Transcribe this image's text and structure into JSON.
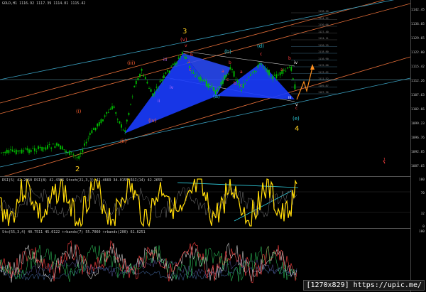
{
  "header": {
    "symbol_info": "GOLD,H1  1116.92 1117.39 1114.81 1115.42",
    "rsi_info": "RSI(5) 42.2050  RSI(8) 42.4385  Stoch(21,3,3) 42.4669 34.0155  RSI(14) 42.2655",
    "sto_info": "Sto(55,3,4) 40.7511 45.0122  +rbands(7) 55.7060  +rbands(200) 61.6251"
  },
  "price_axis": [
    "1142.45",
    "1136.05",
    "1129.65",
    "1122.00",
    "1115.42",
    "1112.26",
    "1107.63",
    "1102.66",
    "1099.23",
    "1096.76",
    "1092.85",
    "1087.65"
  ],
  "rsi_axis": [
    "100",
    "70",
    "32",
    "0"
  ],
  "sto_axis": [
    "100",
    "0"
  ],
  "fib_levels": [
    "1138.40",
    "1134.52",
    "1130.66",
    "1127.40",
    "1124.11",
    "1120.25",
    "1118.80",
    "1116.90",
    "1115.00",
    "1113.62",
    "1111.52",
    "1109.87",
    "1107.36"
  ],
  "wave_labels": {
    "w3": "3",
    "w2": "2",
    "w4": "4",
    "v_top": "(v)",
    "iii_paren": "(iii)",
    "iv_paren": "(iv)",
    "i_paren": "(i)",
    "ii_paren": "(ii)",
    "iii": "iii",
    "iv": "iv",
    "ii": "ii",
    "a_paren": "(a)",
    "b_paren": "(b)",
    "d_paren": "(d)",
    "e_paren": "(e)",
    "roman_iv": "iv",
    "roman_v": "v",
    "roman_iii": "iii",
    "a1": "a",
    "b1": "b",
    "c1": "c",
    "a2": "a",
    "b2": "b",
    "c2": "c",
    "a3": "a",
    "b3": "b",
    "c3": "c",
    "c4": "c",
    "a4": "a",
    "b4": "b",
    "c5": "c",
    "v_small": "v",
    "red_mark": "1"
  },
  "watermark": "[1270x829] https://upic.me/",
  "colors": {
    "bg": "#000000",
    "candle": "#00c000",
    "pattern": "#1a3cff",
    "channel_orange": "#e8703a",
    "channel_cyan": "#3aa0c0",
    "wave_red": "#ff4040",
    "wave_yellow": "#ffd020",
    "wave_cyan": "#30d0e0",
    "wave_violet": "#c070ff",
    "rsi_yellow": "#ffe000",
    "rsi_magenta": "#ff30ff",
    "arrow": "#ff9020"
  }
}
